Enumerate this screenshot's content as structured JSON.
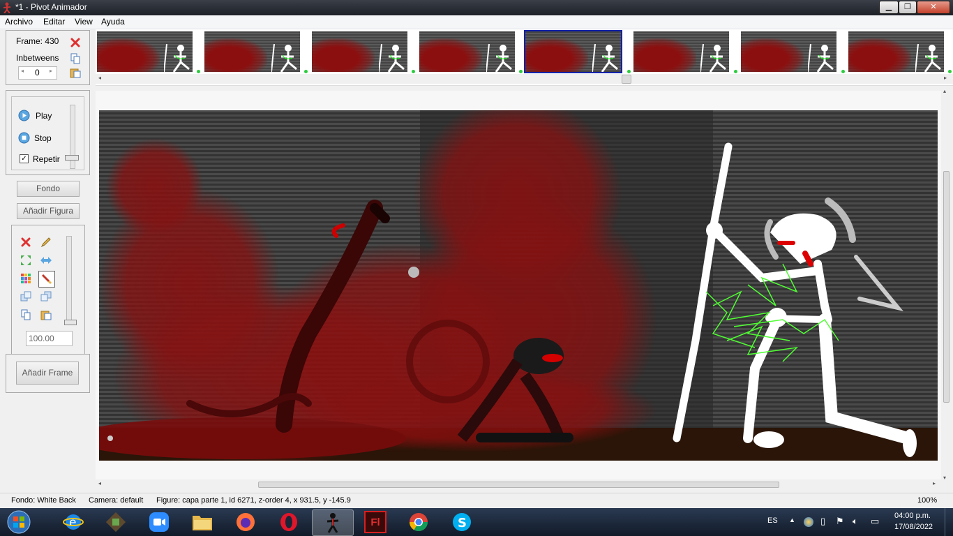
{
  "window": {
    "title": "*1 - Pivot Animador",
    "minimize_label": "▁",
    "maximize_label": "❐",
    "close_label": "✕"
  },
  "menu": [
    "Archivo",
    "Editar",
    "View",
    "Ayuda"
  ],
  "frame_panel": {
    "frame_label": "Frame: 430",
    "inbetweens_label": "Inbetweens",
    "inbetweens_value": "0"
  },
  "playback": {
    "play_label": "Play",
    "stop_label": "Stop",
    "repeat_label": "Repetir",
    "repeat_checked": true,
    "checkbox_mark": "✓"
  },
  "buttons": {
    "background_label": "Fondo",
    "add_figure_label": "Añadir Figura",
    "add_frame_label": "Añadir Frame"
  },
  "tools": {
    "scale_value": "100.00",
    "icons": [
      "delete-icon",
      "pencil-icon",
      "resize-icon",
      "flip-icon",
      "color-icon",
      "brush-icon",
      "front-icon",
      "back-icon",
      "copy-icon",
      "paste-icon"
    ]
  },
  "filmstrip": {
    "frame_count": 8,
    "selected_index": 4
  },
  "status": {
    "fondo": "Fondo: White Back",
    "camera": "Camera: default",
    "figure": "Figure: capa parte 1,  id 6271,  z-order 4,  x 931.5, y -145.9",
    "zoom": "100%"
  },
  "taskbar": {
    "apps": [
      "start-orb",
      "internet-explorer",
      "minecraft",
      "zoom",
      "file-explorer",
      "firefox",
      "opera",
      "pivot-animator",
      "flash",
      "chrome",
      "skype"
    ],
    "active_app": "pivot-animator",
    "language": "ES",
    "time": "04:00 p.m.",
    "date": "17/08/2022",
    "flash_label": "Fl"
  },
  "colors": {
    "accent_selection": "#1222a8",
    "blood": "#8c0f0f",
    "canvas_bg": "#3a3a3a",
    "taskbar": "#1a2638"
  }
}
